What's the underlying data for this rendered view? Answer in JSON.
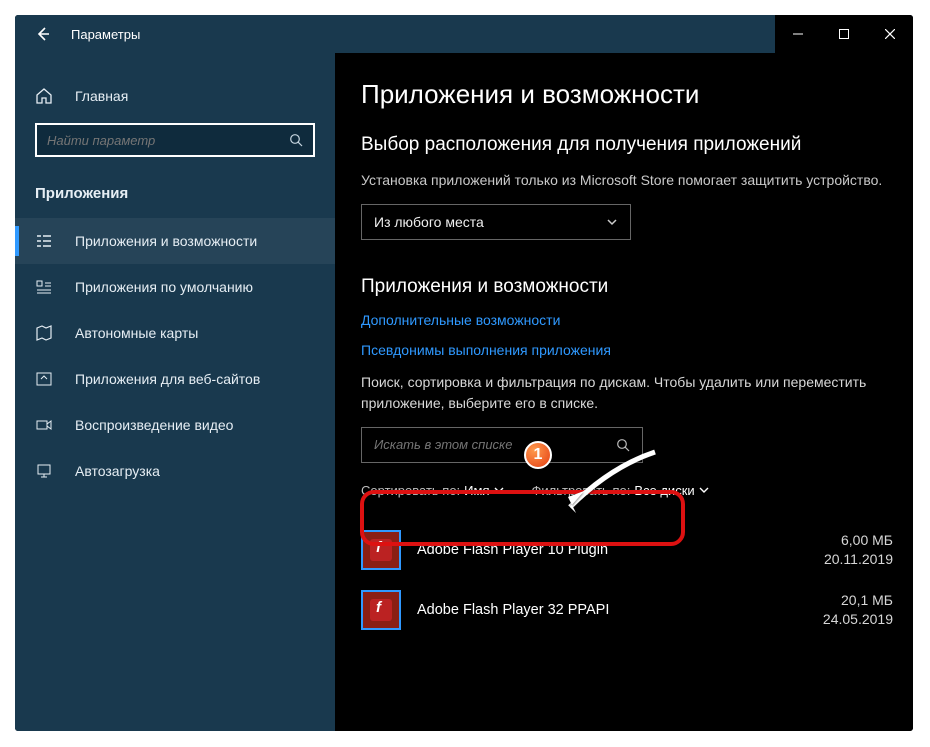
{
  "window": {
    "title": "Параметры"
  },
  "sidebar": {
    "home": "Главная",
    "search_placeholder": "Найти параметр",
    "category": "Приложения",
    "items": [
      {
        "label": "Приложения и возможности"
      },
      {
        "label": "Приложения по умолчанию"
      },
      {
        "label": "Автономные карты"
      },
      {
        "label": "Приложения для веб-сайтов"
      },
      {
        "label": "Воспроизведение видео"
      },
      {
        "label": "Автозагрузка"
      }
    ]
  },
  "main": {
    "h1": "Приложения и возможности",
    "source_heading": "Выбор расположения для получения приложений",
    "source_desc": "Установка приложений только из Microsoft Store помогает защитить устройство.",
    "source_value": "Из любого места",
    "h2": "Приложения и возможности",
    "link_optional": "Дополнительные возможности",
    "link_alias": "Псевдонимы выполнения приложения",
    "list_desc": "Поиск, сортировка и фильтрация по дискам. Чтобы удалить или переместить приложение, выберите его в списке.",
    "list_search_placeholder": "Искать в этом списке",
    "sort_label": "Сортировать по:",
    "sort_value": "Имя",
    "filter_label": "Фильтровать по:",
    "filter_value": "Все диски",
    "apps": [
      {
        "name": "Adobe Flash Player 10 Plugin",
        "size": "6,00 МБ",
        "date": "20.11.2019"
      },
      {
        "name": "Adobe Flash Player 32 PPAPI",
        "size": "20,1 МБ",
        "date": "24.05.2019"
      }
    ]
  },
  "annotation": {
    "badge": "1"
  }
}
